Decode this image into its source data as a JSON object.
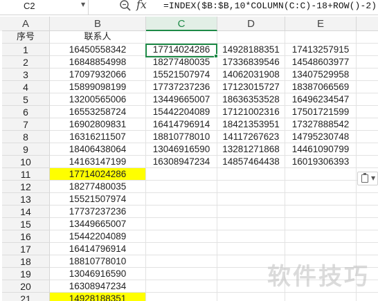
{
  "formula_bar": {
    "name_box": "C2",
    "fx_label": "fx",
    "formula": "=INDEX($B:$B,10*COLUMN(C:C)-18+ROW()-2)"
  },
  "columns": [
    "A",
    "B",
    "C",
    "D",
    "E"
  ],
  "header_row": {
    "a": "序号",
    "b": "联系人"
  },
  "rows": [
    {
      "num": "1",
      "a": "1",
      "b": "16450558342",
      "c": "17714024286",
      "d": "14928188351",
      "e": "17413257915",
      "hl": false
    },
    {
      "num": "2",
      "a": "2",
      "b": "16848854998",
      "c": "18277480035",
      "d": "17336839546",
      "e": "14548603977",
      "hl": false
    },
    {
      "num": "3",
      "a": "3",
      "b": "17097932066",
      "c": "15521507974",
      "d": "14062031908",
      "e": "13407529958",
      "hl": false
    },
    {
      "num": "4",
      "a": "4",
      "b": "15899098199",
      "c": "17737237236",
      "d": "17123015727",
      "e": "18387066569",
      "hl": false
    },
    {
      "num": "5",
      "a": "5",
      "b": "13200565006",
      "c": "13449665007",
      "d": "18636353528",
      "e": "16496234547",
      "hl": false
    },
    {
      "num": "6",
      "a": "6",
      "b": "16553258724",
      "c": "15442204089",
      "d": "17121002316",
      "e": "17501721599",
      "hl": false
    },
    {
      "num": "7",
      "a": "7",
      "b": "16902809831",
      "c": "16414796914",
      "d": "18421353951",
      "e": "17327888542",
      "hl": false
    },
    {
      "num": "8",
      "a": "8",
      "b": "16316211507",
      "c": "18810778010",
      "d": "14117267623",
      "e": "14795230748",
      "hl": false
    },
    {
      "num": "9",
      "a": "9",
      "b": "18406438064",
      "c": "13046916590",
      "d": "13281271868",
      "e": "14461090799",
      "hl": false
    },
    {
      "num": "10",
      "a": "10",
      "b": "14163147199",
      "c": "16308947234",
      "d": "14857464438",
      "e": "16019306393",
      "hl": false
    },
    {
      "num": "11",
      "a": "11",
      "b": "17714024286",
      "c": "",
      "d": "",
      "e": "",
      "hl": true
    },
    {
      "num": "12",
      "a": "12",
      "b": "18277480035",
      "c": "",
      "d": "",
      "e": "",
      "hl": false
    },
    {
      "num": "13",
      "a": "13",
      "b": "15521507974",
      "c": "",
      "d": "",
      "e": "",
      "hl": false
    },
    {
      "num": "14",
      "a": "14",
      "b": "17737237236",
      "c": "",
      "d": "",
      "e": "",
      "hl": false
    },
    {
      "num": "15",
      "a": "15",
      "b": "13449665007",
      "c": "",
      "d": "",
      "e": "",
      "hl": false
    },
    {
      "num": "16",
      "a": "16",
      "b": "15442204089",
      "c": "",
      "d": "",
      "e": "",
      "hl": false
    },
    {
      "num": "17",
      "a": "17",
      "b": "16414796914",
      "c": "",
      "d": "",
      "e": "",
      "hl": false
    },
    {
      "num": "18",
      "a": "18",
      "b": "18810778010",
      "c": "",
      "d": "",
      "e": "",
      "hl": false
    },
    {
      "num": "19",
      "a": "19",
      "b": "13046916590",
      "c": "",
      "d": "",
      "e": "",
      "hl": false
    },
    {
      "num": "20",
      "a": "20",
      "b": "16308947234",
      "c": "",
      "d": "",
      "e": "",
      "hl": false
    },
    {
      "num": "21",
      "a": "21",
      "b": "14928188351",
      "c": "",
      "d": "",
      "e": "",
      "hl": true
    }
  ],
  "highlight_color": "#ffff00",
  "selection_color": "#1e8a47",
  "watermark": "软件技巧"
}
